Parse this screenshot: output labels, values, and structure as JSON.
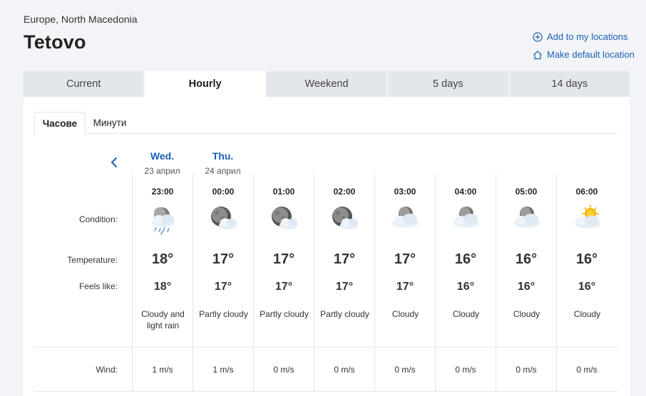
{
  "header": {
    "region": "Europe, North Macedonia",
    "city": "Tetovo",
    "add_location": "Add to my locations",
    "make_default": "Make default location"
  },
  "tabs": [
    {
      "label": "Current",
      "active": false
    },
    {
      "label": "Hourly",
      "active": true
    },
    {
      "label": "Weekend",
      "active": false
    },
    {
      "label": "5 days",
      "active": false
    },
    {
      "label": "14 days",
      "active": false
    }
  ],
  "subtabs": [
    {
      "label": "Часове",
      "active": true
    },
    {
      "label": "Минути",
      "active": false
    }
  ],
  "days": [
    {
      "name": "Wed.",
      "date": "23 април"
    },
    {
      "name": "Thu.",
      "date": "24 април"
    }
  ],
  "row_labels": {
    "condition": "Condition:",
    "temperature": "Temperature:",
    "feels_like": "Feels like:",
    "wind": "Wind:"
  },
  "hours": [
    {
      "time": "23:00",
      "icon": "night-cloud-rain-icon",
      "temp": "18°",
      "feels": "18°",
      "desc": "Cloudy and light rain",
      "wind": "1 m/s"
    },
    {
      "time": "00:00",
      "icon": "moon-cloud-icon",
      "temp": "17°",
      "feels": "17°",
      "desc": "Partly cloudy",
      "wind": "1 m/s"
    },
    {
      "time": "01:00",
      "icon": "moon-cloud-icon",
      "temp": "17°",
      "feels": "17°",
      "desc": "Partly cloudy",
      "wind": "0 m/s"
    },
    {
      "time": "02:00",
      "icon": "moon-cloud-icon",
      "temp": "17°",
      "feels": "17°",
      "desc": "Partly cloudy",
      "wind": "0 m/s"
    },
    {
      "time": "03:00",
      "icon": "night-cloudy-icon",
      "temp": "17°",
      "feels": "17°",
      "desc": "Cloudy",
      "wind": "0 m/s"
    },
    {
      "time": "04:00",
      "icon": "night-cloudy-icon",
      "temp": "16°",
      "feels": "16°",
      "desc": "Cloudy",
      "wind": "0 m/s"
    },
    {
      "time": "05:00",
      "icon": "night-cloudy-icon",
      "temp": "16°",
      "feels": "16°",
      "desc": "Cloudy",
      "wind": "0 m/s"
    },
    {
      "time": "06:00",
      "icon": "sun-cloudy-icon",
      "temp": "16°",
      "feels": "16°",
      "desc": "Cloudy",
      "wind": "0 m/s"
    }
  ],
  "colors": {
    "accent": "#1a5fb4",
    "tab_bg": "#e3e7ec",
    "page_bg": "#f2f4f7"
  }
}
